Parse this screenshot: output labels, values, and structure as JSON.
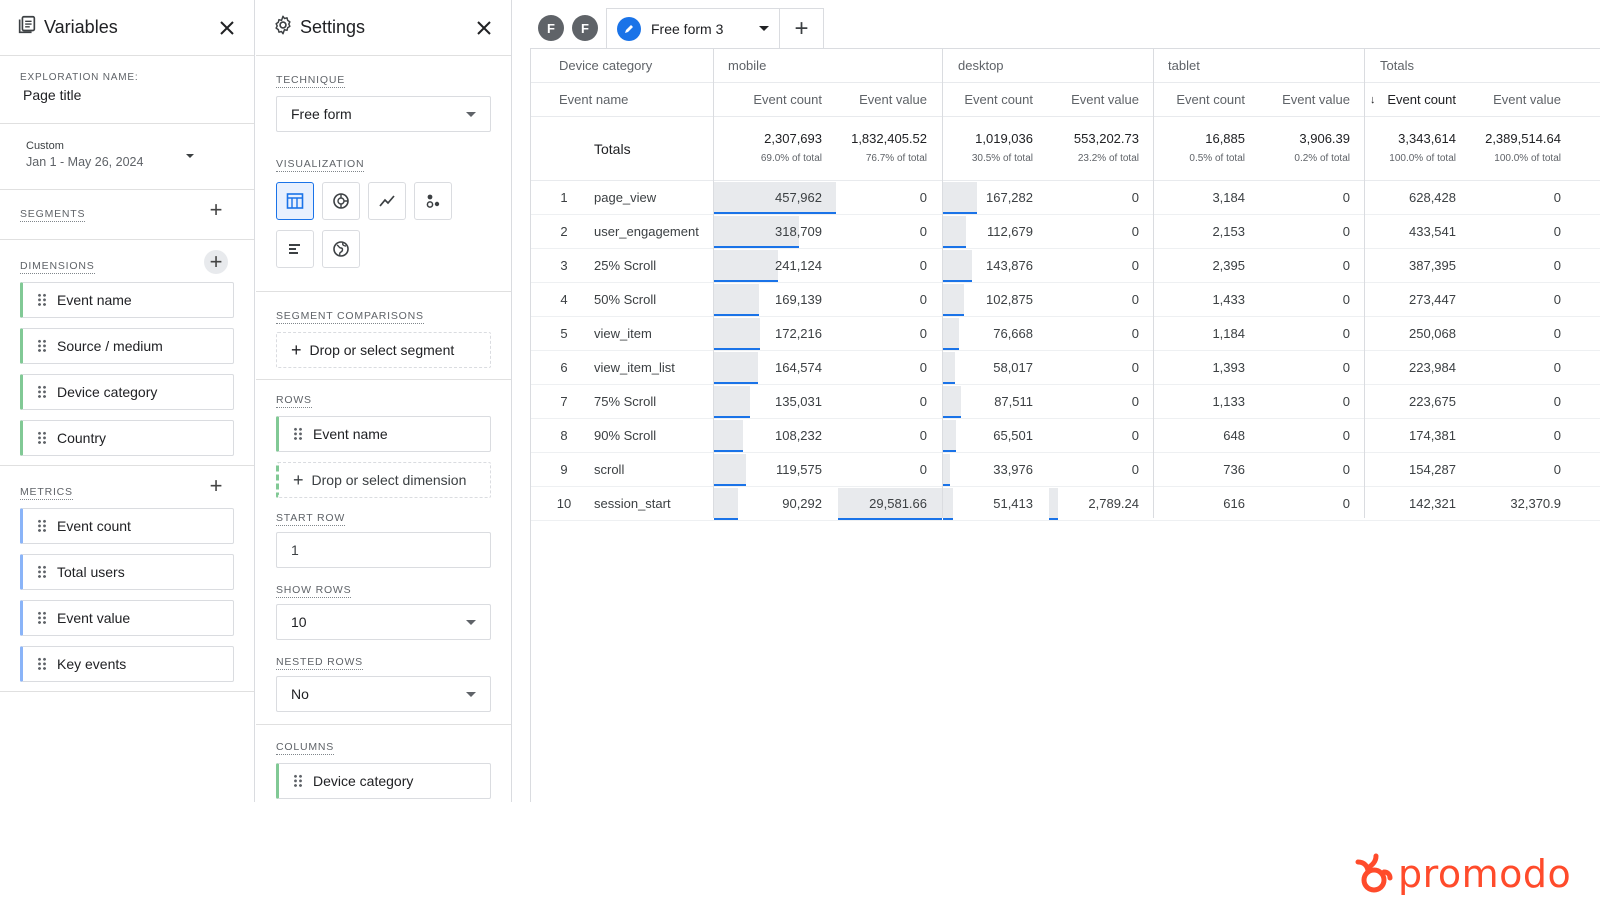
{
  "variables": {
    "title": "Variables",
    "exploration_name_label": "EXPLORATION NAME:",
    "exploration_name": "Page title",
    "date_label": "Custom",
    "date_range": "Jan 1 - May 26, 2024",
    "segments_label": "SEGMENTS",
    "dimensions_label": "DIMENSIONS",
    "dimensions": [
      "Event name",
      "Source / medium",
      "Device category",
      "Country"
    ],
    "metrics_label": "METRICS",
    "metrics": [
      "Event count",
      "Total users",
      "Event value",
      "Key events"
    ]
  },
  "settings": {
    "title": "Settings",
    "technique_label": "TECHNIQUE",
    "technique": "Free form",
    "visualization_label": "VISUALIZATION",
    "segment_comparisons_label": "SEGMENT COMPARISONS",
    "segment_drop": "Drop or select segment",
    "rows_label": "ROWS",
    "rows_dimension": "Event name",
    "dimension_drop": "Drop or select dimension",
    "start_row_label": "START ROW",
    "start_row": "1",
    "show_rows_label": "SHOW ROWS",
    "show_rows": "10",
    "nested_rows_label": "NESTED ROWS",
    "nested_rows": "No",
    "columns_label": "COLUMNS",
    "columns_dimension": "Device category"
  },
  "tabs": {
    "f1": "F",
    "f2": "F",
    "active": "Free form 3",
    "add": "+"
  },
  "table": {
    "dim_header": "Device category",
    "row_header": "Event name",
    "groups": [
      "mobile",
      "desktop",
      "tablet",
      "Totals"
    ],
    "metric_headers": [
      "Event count",
      "Event value",
      "Event count",
      "Event value",
      "Event count",
      "Event value",
      "Event count",
      "Event value"
    ],
    "totals_label": "Totals",
    "totals": [
      "2,307,693",
      "1,832,405.52",
      "1,019,036",
      "553,202.73",
      "16,885",
      "3,906.39",
      "3,343,614",
      "2,389,514.64"
    ],
    "totals_pct": [
      "69.0% of total",
      "76.7% of total",
      "30.5% of total",
      "23.2% of total",
      "0.5% of total",
      "0.2% of total",
      "100.0% of total",
      "100.0% of total"
    ],
    "rows": [
      {
        "n": "1",
        "event": "page_view",
        "v": [
          "457,962",
          "0",
          "167,282",
          "0",
          "3,184",
          "0",
          "628,428",
          "0"
        ]
      },
      {
        "n": "2",
        "event": "user_engagement",
        "v": [
          "318,709",
          "0",
          "112,679",
          "0",
          "2,153",
          "0",
          "433,541",
          "0"
        ]
      },
      {
        "n": "3",
        "event": "25% Scroll",
        "v": [
          "241,124",
          "0",
          "143,876",
          "0",
          "2,395",
          "0",
          "387,395",
          "0"
        ]
      },
      {
        "n": "4",
        "event": "50% Scroll",
        "v": [
          "169,139",
          "0",
          "102,875",
          "0",
          "1,433",
          "0",
          "273,447",
          "0"
        ]
      },
      {
        "n": "5",
        "event": "view_item",
        "v": [
          "172,216",
          "0",
          "76,668",
          "0",
          "1,184",
          "0",
          "250,068",
          "0"
        ]
      },
      {
        "n": "6",
        "event": "view_item_list",
        "v": [
          "164,574",
          "0",
          "58,017",
          "0",
          "1,393",
          "0",
          "223,984",
          "0"
        ]
      },
      {
        "n": "7",
        "event": "75% Scroll",
        "v": [
          "135,031",
          "0",
          "87,511",
          "0",
          "1,133",
          "0",
          "223,675",
          "0"
        ]
      },
      {
        "n": "8",
        "event": "90% Scroll",
        "v": [
          "108,232",
          "0",
          "65,501",
          "0",
          "648",
          "0",
          "174,381",
          "0"
        ]
      },
      {
        "n": "9",
        "event": "scroll",
        "v": [
          "119,575",
          "0",
          "33,976",
          "0",
          "736",
          "0",
          "154,287",
          "0"
        ]
      },
      {
        "n": "10",
        "event": "session_start",
        "v": [
          "90,292",
          "29,581.66",
          "51,413",
          "2,789.24",
          "616",
          "0",
          "142,321",
          "32,370.9"
        ]
      }
    ]
  },
  "logo_text": "promodo",
  "colors": {
    "accent": "#1a73e8",
    "dim_chip": "#81c995",
    "metric_chip": "#8ab4f8",
    "logo": "#ff4b2b"
  }
}
